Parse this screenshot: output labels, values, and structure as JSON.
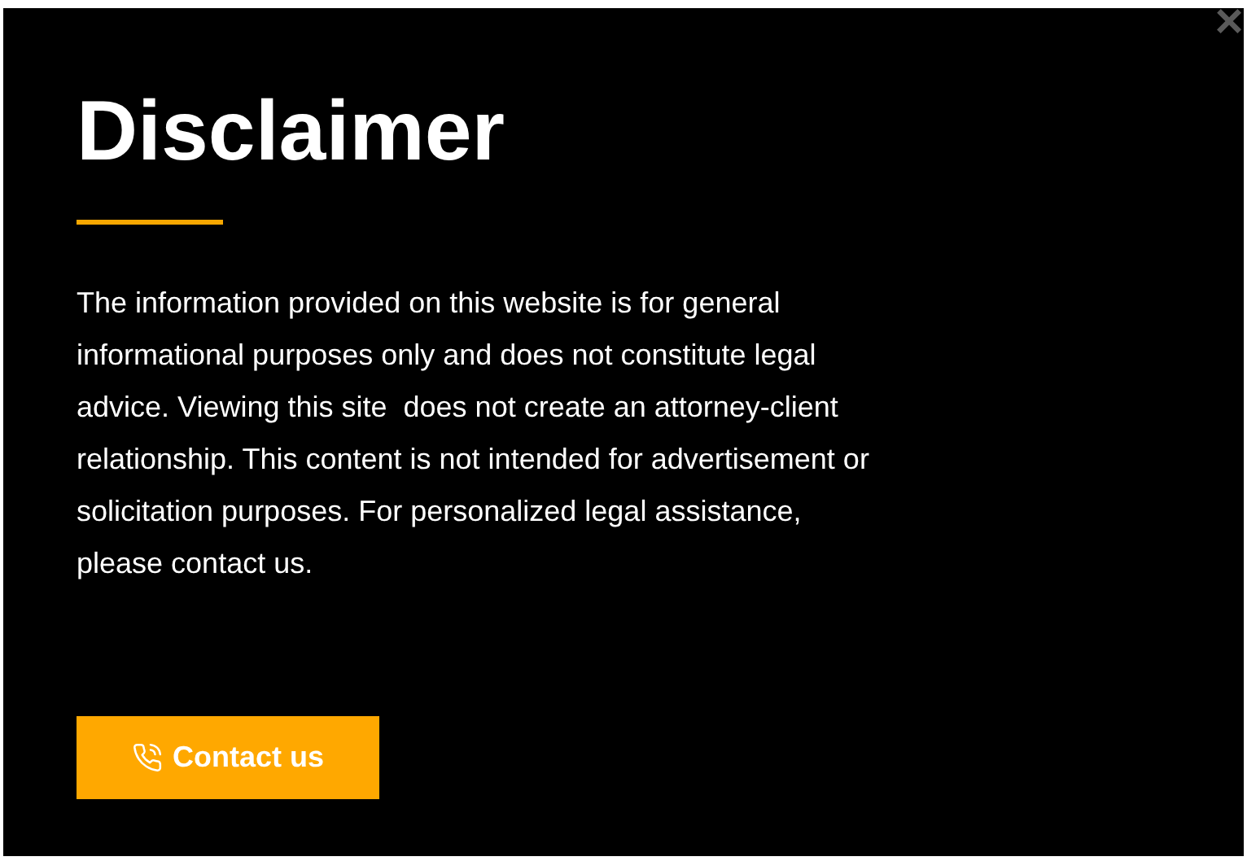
{
  "modal": {
    "close": "×",
    "title": "Disclaimer",
    "body": "The information provided on this website is for general informational purposes only and does not constitute legal advice. Viewing this site  does not create an attorney-client relationship. This content is not intended for advertisement or solicitation purposes. For personalized legal assistance, please contact us.",
    "button": "Contact us"
  }
}
